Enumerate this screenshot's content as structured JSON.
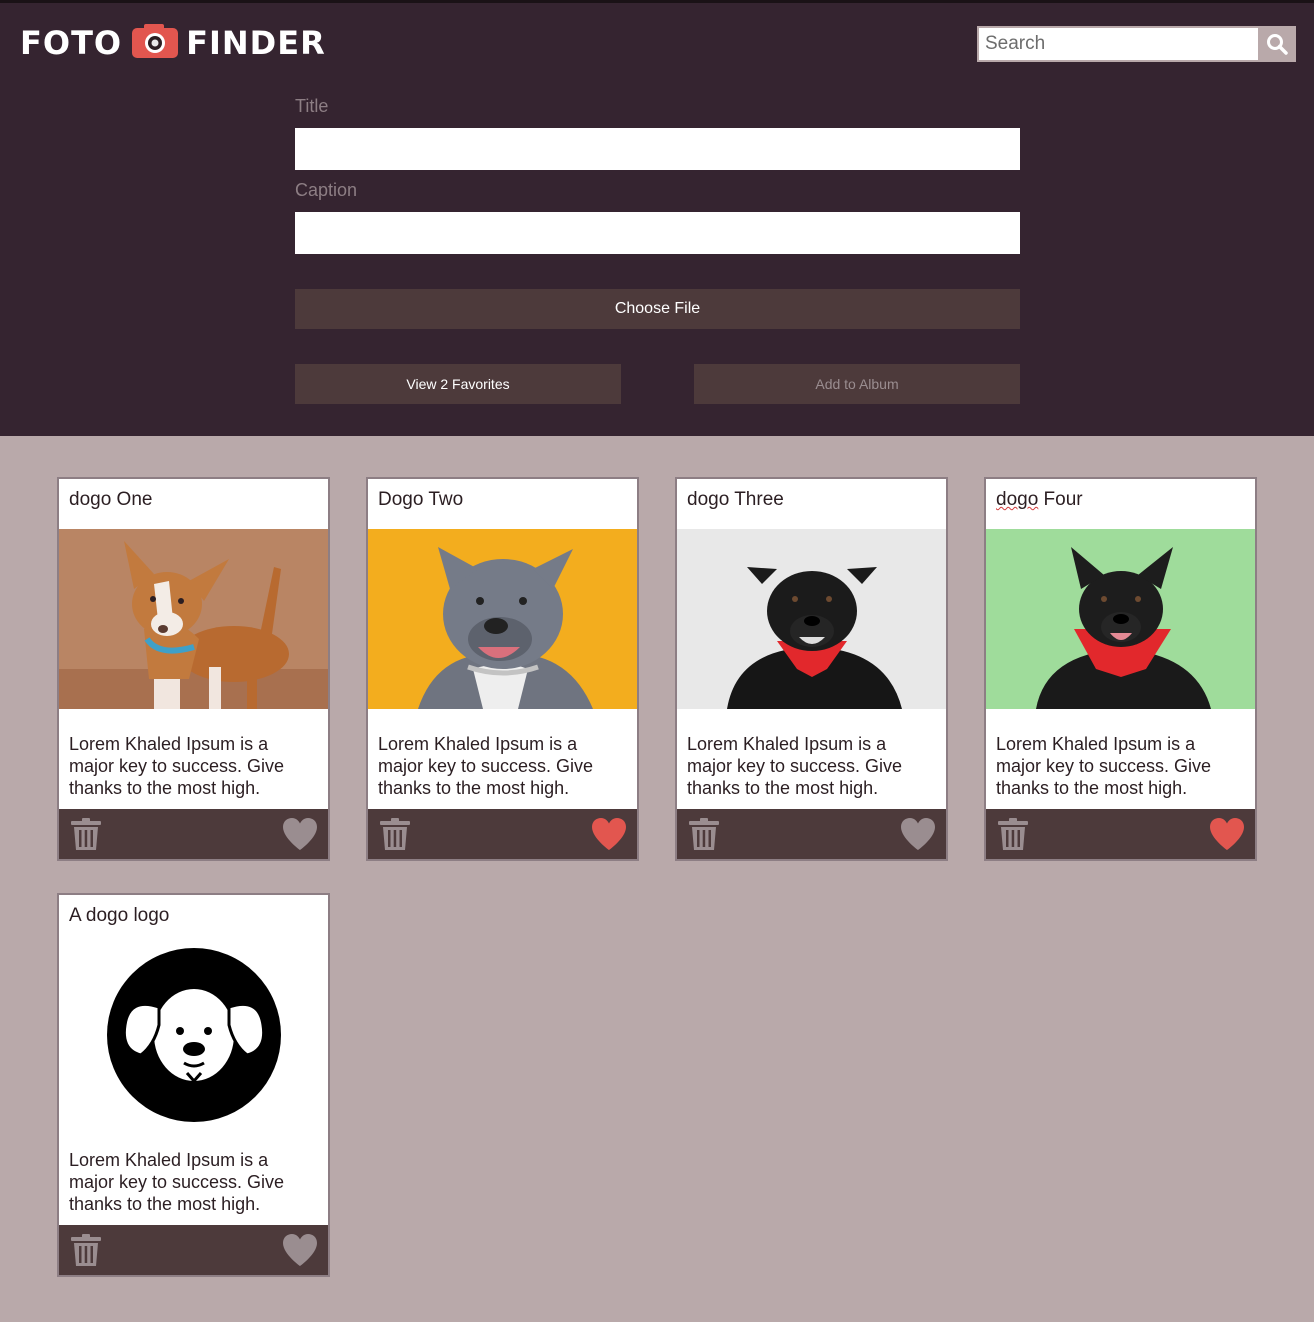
{
  "header": {
    "logo_left": "FOTO",
    "logo_right": "FINDER",
    "search_placeholder": "Search"
  },
  "form": {
    "title_label": "Title",
    "title_value": "",
    "caption_label": "Caption",
    "caption_value": "",
    "choose_file_label": "Choose File",
    "view_favorites_label": "View 2 Favorites",
    "add_to_album_label": "Add to Album"
  },
  "colors": {
    "header_bg": "#352430",
    "page_bg": "#b9a9aa",
    "button_bg": "#4d3a3b",
    "accent_red": "#e2564f",
    "heart_inactive": "#9a8d90"
  },
  "cards": [
    {
      "title_a": "dogo One",
      "title_b": "",
      "caption": "Lorem Khaled Ipsum is a major key to success. Give thanks to the most high.",
      "favorite": false,
      "image": "dog-one"
    },
    {
      "title_a": "Dogo Two",
      "title_b": "",
      "caption": "Lorem Khaled Ipsum is a major key to success. Give thanks to the most high.",
      "favorite": true,
      "image": "dog-two"
    },
    {
      "title_a": "dogo Three",
      "title_b": "",
      "caption": "Lorem Khaled Ipsum is a major key to success. Give thanks to the most high.",
      "favorite": false,
      "image": "dog-three"
    },
    {
      "title_a": "dogo",
      "title_b": " Four",
      "caption": "Lorem Khaled Ipsum is a major key to success. Give thanks to the most high.",
      "favorite": true,
      "image": "dog-four"
    },
    {
      "title_a": "A dogo logo",
      "title_b": "",
      "caption": "Lorem Khaled Ipsum is a major key to success. Give thanks to the most high.",
      "favorite": false,
      "image": "dogo-logo"
    }
  ]
}
